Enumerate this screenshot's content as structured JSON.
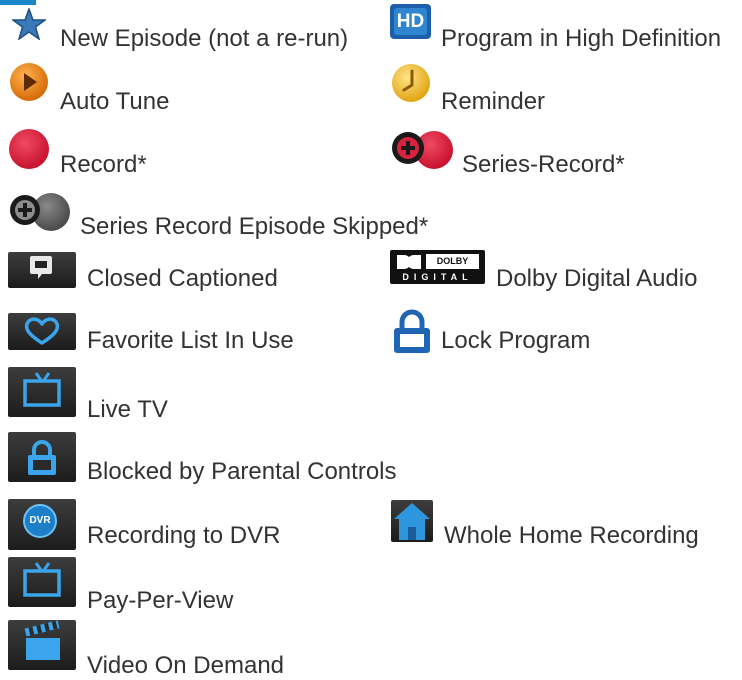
{
  "colors": {
    "text": "#333333",
    "accent_blue": "#1b87c9",
    "record_red": "#d9233e",
    "auto_tune_orange": "#e8831a",
    "reminder_yellow": "#f2c234",
    "dark_tile": "#2a2a2a",
    "tile_icon_blue": "#3a9fe0"
  },
  "legend": {
    "new_episode": {
      "icon": "star-icon",
      "label": "New Episode (not a re-run)"
    },
    "hd": {
      "icon": "hd-badge-icon",
      "badge_text": "HD",
      "label": "Program in High Definition"
    },
    "auto_tune": {
      "icon": "auto-tune-play-icon",
      "label": "Auto Tune"
    },
    "reminder": {
      "icon": "reminder-clock-icon",
      "label": "Reminder"
    },
    "record": {
      "icon": "record-dot-icon",
      "label": "Record*"
    },
    "series_record": {
      "icon": "series-record-icon",
      "label": "Series-Record*"
    },
    "series_skipped": {
      "icon": "series-record-skipped-icon",
      "label": "Series Record Episode Skipped*"
    },
    "closed_captioned": {
      "icon": "closed-caption-icon",
      "label": "Closed Captioned"
    },
    "dolby": {
      "icon": "dolby-digital-icon",
      "badge_top": "DOLBY",
      "badge_bottom": "DIGITAL",
      "label": "Dolby Digital Audio"
    },
    "favorite": {
      "icon": "heart-icon",
      "label": "Favorite List In Use"
    },
    "lock": {
      "icon": "lock-icon",
      "label": "Lock Program"
    },
    "live_tv": {
      "icon": "tv-icon",
      "label": "Live TV"
    },
    "blocked": {
      "icon": "padlock-tile-icon",
      "label": "Blocked by Parental Controls"
    },
    "recording_dvr": {
      "icon": "dvr-icon",
      "badge_text": "DVR",
      "label": "Recording to DVR"
    },
    "whole_home": {
      "icon": "house-icon",
      "label": "Whole Home Recording"
    },
    "pay_per_view": {
      "icon": "tv-icon",
      "label": "Pay-Per-View"
    },
    "vod": {
      "icon": "clapperboard-icon",
      "label": "Video On Demand"
    }
  }
}
